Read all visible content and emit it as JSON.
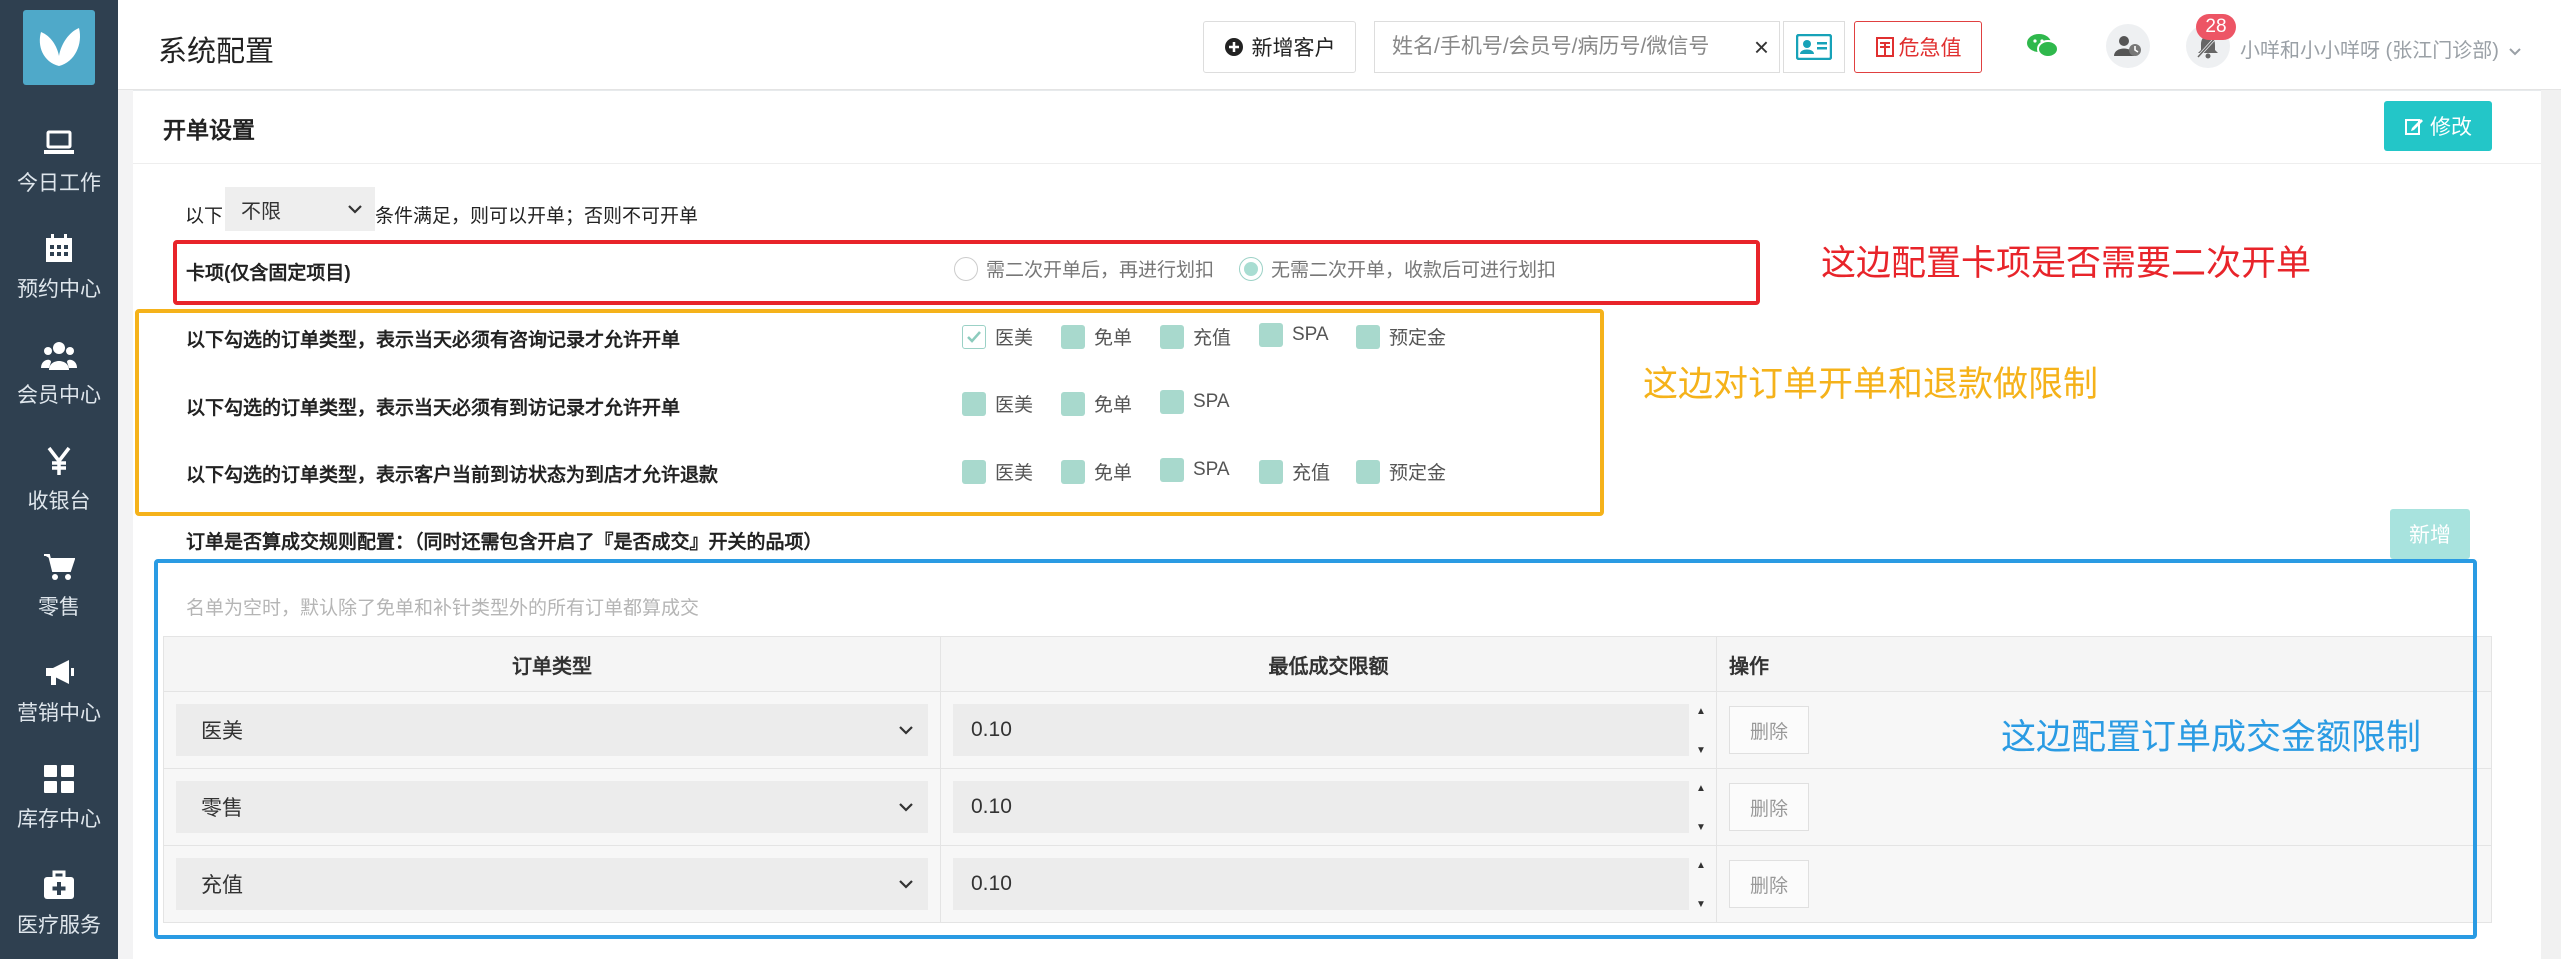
{
  "sidebar": {
    "items": [
      {
        "label": "今日工作",
        "icon": "laptop-icon"
      },
      {
        "label": "预约中心",
        "icon": "calendar-icon"
      },
      {
        "label": "会员中心",
        "icon": "users-icon"
      },
      {
        "label": "收银台",
        "icon": "yen-icon"
      },
      {
        "label": "零售",
        "icon": "cart-icon"
      },
      {
        "label": "营销中心",
        "icon": "megaphone-icon"
      },
      {
        "label": "库存中心",
        "icon": "grid-icon"
      },
      {
        "label": "医疗服务",
        "icon": "medkit-icon"
      }
    ]
  },
  "header": {
    "title": "系统配置",
    "add_customer_label": "新增客户",
    "search_placeholder": "姓名/手机号/会员号/病历号/微信号",
    "clear_symbol": "×",
    "critical_label": "危急值",
    "notification_count": "28",
    "user_name": "小咩和小小咩呀 (张江门诊部)"
  },
  "panel": {
    "title": "开单设置",
    "edit_label": "修改",
    "condition_prefix": "以下",
    "condition_value": "不限",
    "condition_suffix": "条件满足，则可以开单；否则不可开单",
    "card_row": {
      "label": "卡项(仅含固定项目)",
      "option_a": "需二次开单后，再进行划扣",
      "option_b": "无需二次开单，收款后可进行划扣"
    },
    "consult_row": {
      "label": "以下勾选的订单类型，表示当天必须有咨询记录才允许开单",
      "options": [
        "医美",
        "免单",
        "充值",
        "SPA",
        "预定金"
      ]
    },
    "visit_row": {
      "label": "以下勾选的订单类型，表示当天必须有到访记录才允许开单",
      "options": [
        "医美",
        "免单",
        "SPA"
      ]
    },
    "refund_row": {
      "label": "以下勾选的订单类型，表示客户当前到访状态为到店才允许退款",
      "options": [
        "医美",
        "免单",
        "SPA",
        "充值",
        "预定金"
      ]
    },
    "deal_rule_label": "订单是否算成交规则配置：（同时还需包含开启了『是否成交』开关的品项）",
    "new_label": "新增",
    "empty_hint": "名单为空时，默认除了免单和补针类型外的所有订单都算成交",
    "table": {
      "headers": [
        "订单类型",
        "最低成交限额",
        "操作"
      ],
      "rows": [
        {
          "type": "医美",
          "amount": "0.10",
          "action": "删除"
        },
        {
          "type": "零售",
          "amount": "0.10",
          "action": "删除"
        },
        {
          "type": "充值",
          "amount": "0.10",
          "action": "删除"
        }
      ]
    }
  },
  "annotations": {
    "red": "这边配置卡项是否需要二次开单",
    "orange": "这边对订单开单和退款做限制",
    "blue": "这边配置订单成交金额限制"
  },
  "colors": {
    "sidebar": "#2f4050",
    "accent_teal": "#23c6c8",
    "annot_red": "#e8242a",
    "annot_orange": "#f5b21a",
    "annot_blue": "#2a9be3",
    "checkbox": "#a8d9cd"
  }
}
